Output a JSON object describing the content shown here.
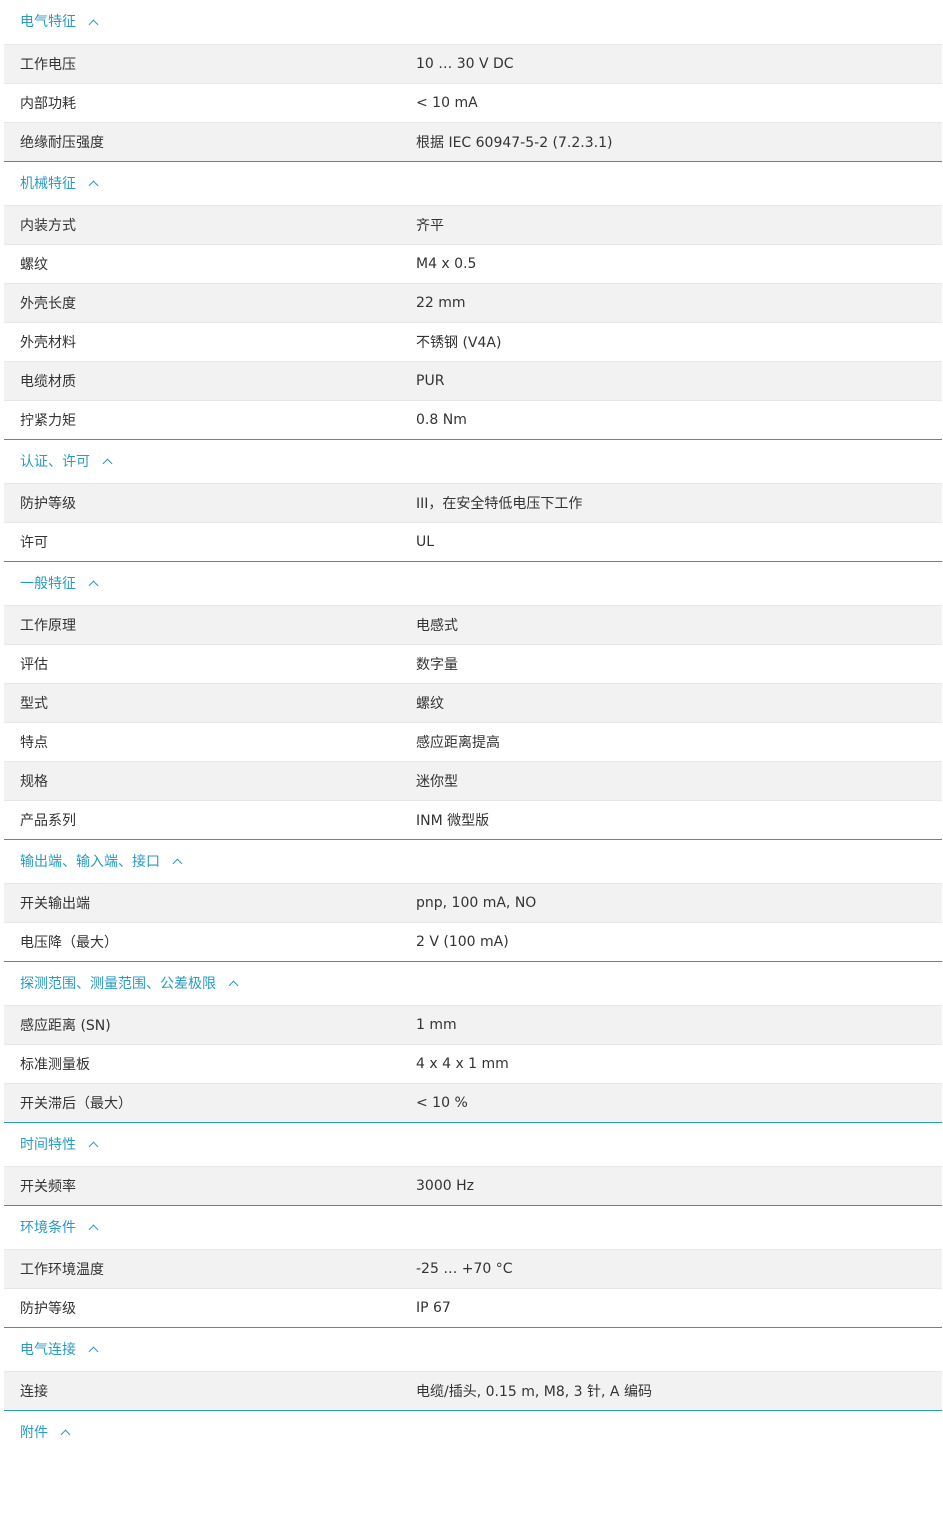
{
  "sections": [
    {
      "title": "电气特征",
      "rows": [
        {
          "label": "工作电压",
          "value": "10 … 30 V DC"
        },
        {
          "label": "内部功耗",
          "value": "< 10 mA"
        },
        {
          "label": "绝缘耐压强度",
          "value": "根据 IEC 60947-5-2 (7.2.3.1)"
        }
      ]
    },
    {
      "title": "机械特征",
      "rows": [
        {
          "label": "内装方式",
          "value": "齐平"
        },
        {
          "label": "螺纹",
          "value": "M4 x 0.5"
        },
        {
          "label": "外壳长度",
          "value": "22 mm"
        },
        {
          "label": "外壳材料",
          "value": "不锈钢 (V4A)"
        },
        {
          "label": "电缆材质",
          "value": "PUR"
        },
        {
          "label": "拧紧力矩",
          "value": "0.8 Nm"
        }
      ]
    },
    {
      "title": "认证、许可",
      "rows": [
        {
          "label": "防护等级",
          "value": "III，在安全特低电压下工作"
        },
        {
          "label": "许可",
          "value": "UL"
        }
      ]
    },
    {
      "title": "一般特征",
      "rows": [
        {
          "label": "工作原理",
          "value": "电感式"
        },
        {
          "label": "评估",
          "value": "数字量"
        },
        {
          "label": "型式",
          "value": "螺纹"
        },
        {
          "label": "特点",
          "value": "感应距离提高"
        },
        {
          "label": "规格",
          "value": "迷你型"
        },
        {
          "label": "产品系列",
          "value": "INM 微型版"
        }
      ]
    },
    {
      "title": "输出端、输入端、接口",
      "rows": [
        {
          "label": "开关输出端",
          "value": "pnp, 100 mA, NO"
        },
        {
          "label": "电压降（最大）",
          "value": "2 V (100 mA)"
        }
      ]
    },
    {
      "title": "探测范围、测量范围、公差极限",
      "rows": [
        {
          "label": "感应距离 (SN)",
          "value": "1 mm"
        },
        {
          "label": "标准测量板",
          "value": "4 x 4 x 1 mm"
        },
        {
          "label": "开关滞后（最大）",
          "value": "< 10 %"
        }
      ]
    },
    {
      "title": "时间特性",
      "rows": [
        {
          "label": "开关频率",
          "value": "3000 Hz"
        }
      ]
    },
    {
      "title": "环境条件",
      "rows": [
        {
          "label": "工作环境温度",
          "value": "-25 … +70 °C"
        },
        {
          "label": "防护等级",
          "value": "IP 67"
        }
      ]
    },
    {
      "title": "电气连接",
      "rows": [
        {
          "label": "连接",
          "value": "电缆/插头, 0.15 m, M8, 3 针, A 编码"
        }
      ]
    },
    {
      "title": "附件",
      "rows": []
    }
  ],
  "colors": {
    "accent": "#2a9bc0",
    "row_shade": "#f2f2f2",
    "row_divider": "#e8e8e8",
    "text": "#333333"
  },
  "icons": {
    "section_toggle": "chevron-up-icon"
  }
}
